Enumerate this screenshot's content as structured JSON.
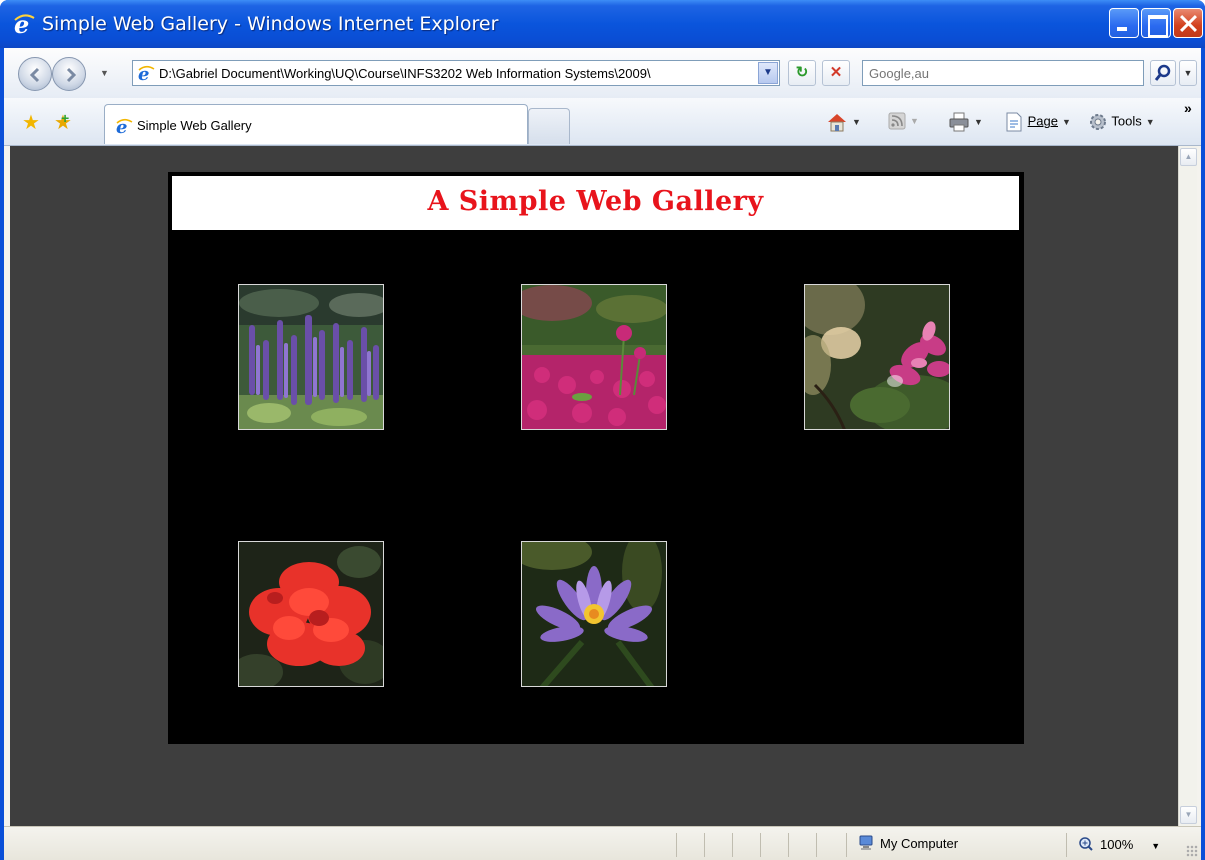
{
  "window": {
    "title": "Simple Web Gallery - Windows Internet Explorer"
  },
  "toolbar": {
    "address": "D:\\Gabriel Document\\Working\\UQ\\Course\\INFS3202 Web Information Systems\\2009\\",
    "search_placeholder": "Google,au",
    "tab_label": "Simple Web Gallery",
    "page_menu": "Page",
    "tools_menu": "Tools"
  },
  "page": {
    "heading": "A Simple Web Gallery",
    "background_color": "#3e3e3e",
    "gallery_background": "#000000",
    "heading_color": "#e8141c",
    "thumbnails": [
      {
        "subject": "purple-salvia-flowers"
      },
      {
        "subject": "magenta-globe-amaranth-flowers"
      },
      {
        "subject": "pink-orchid-tree-flower"
      },
      {
        "subject": "red-hibiscus-flower"
      },
      {
        "subject": "purple-water-lily"
      }
    ]
  },
  "statusbar": {
    "zone": "My Computer",
    "zoom": "100%"
  }
}
